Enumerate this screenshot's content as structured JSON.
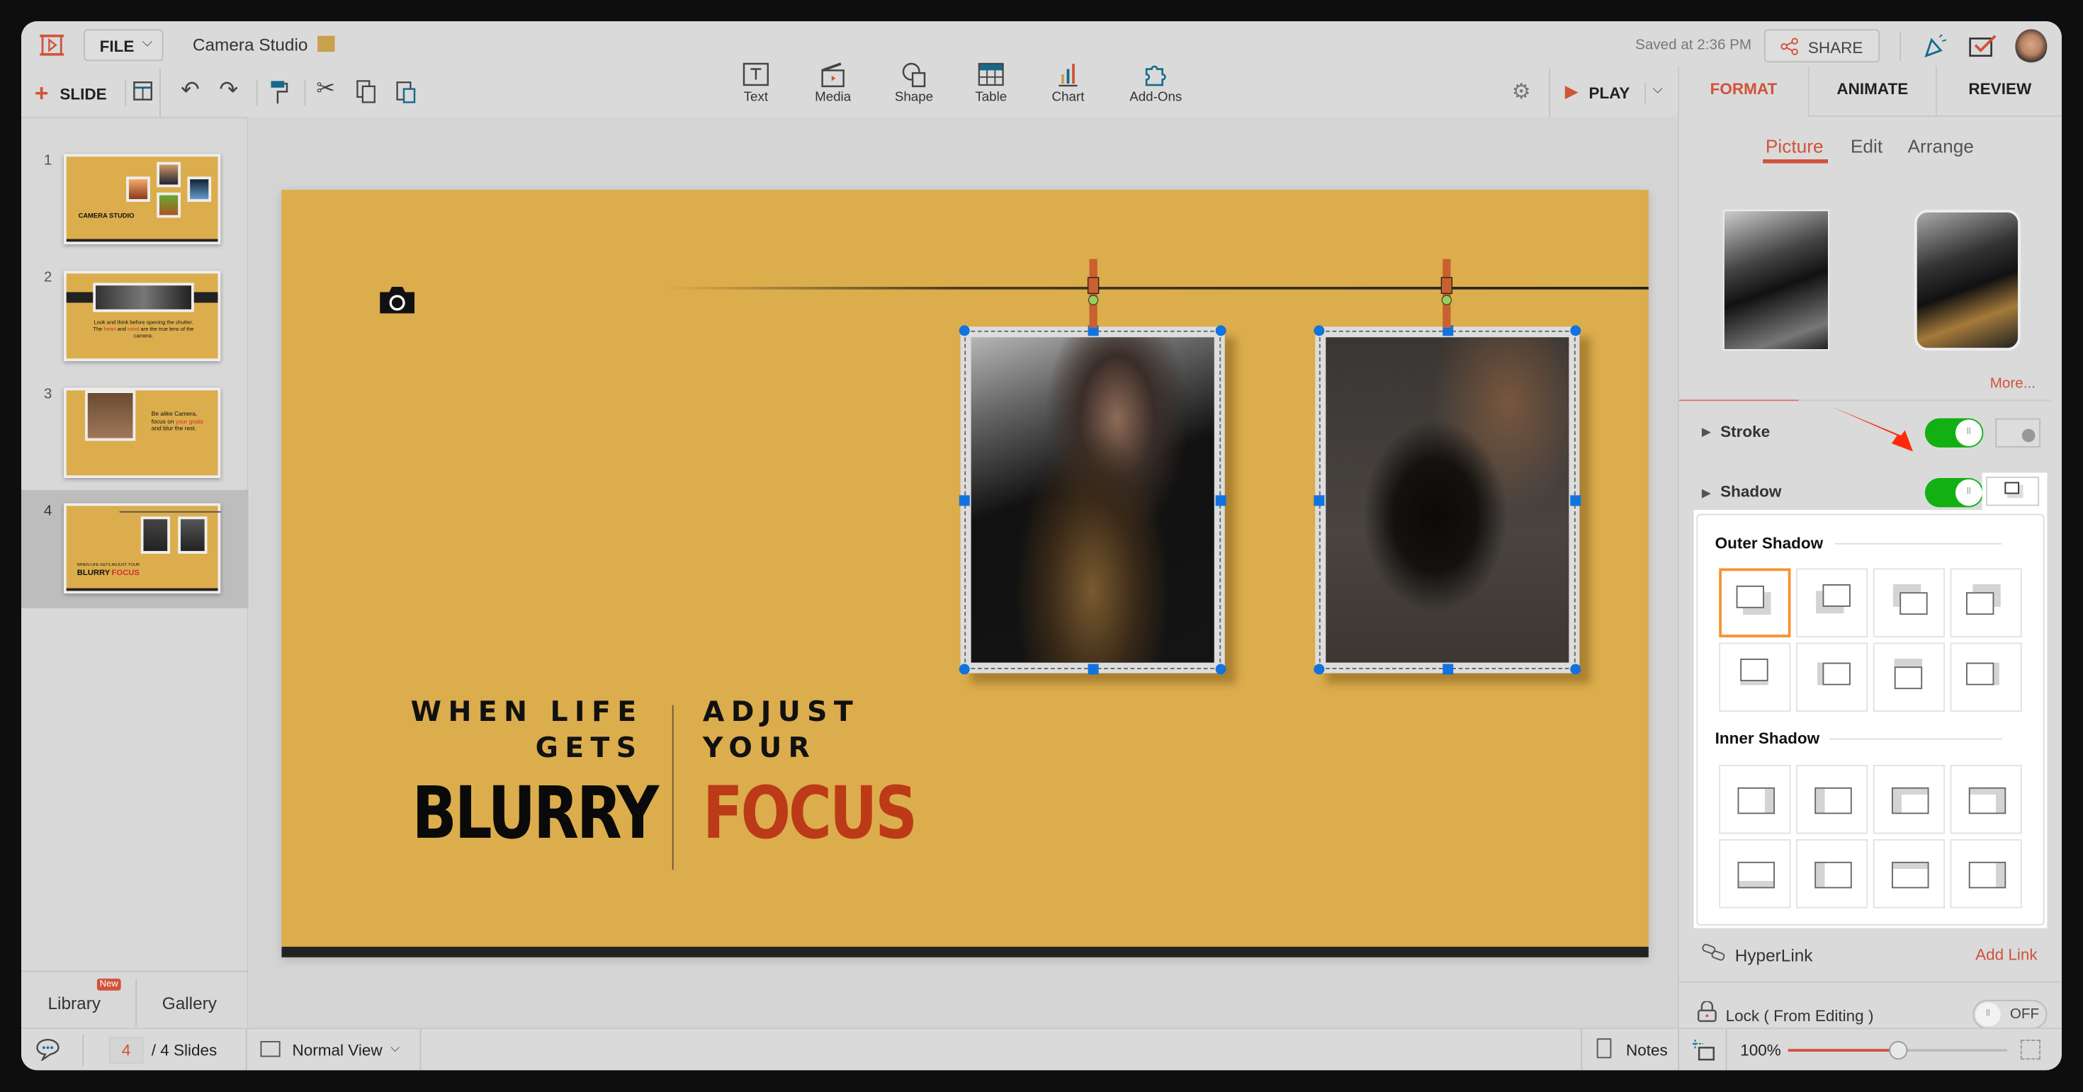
{
  "header": {
    "file_label": "FILE",
    "doc_title": "Camera Studio",
    "saved_status": "Saved at 2:36 PM",
    "share_label": "SHARE"
  },
  "toolbar": {
    "slide_label": "SLIDE",
    "insert_tools": [
      "Text",
      "Media",
      "Shape",
      "Table",
      "Chart",
      "Add-Ons"
    ],
    "play_label": "PLAY"
  },
  "right_tabs": [
    "FORMAT",
    "ANIMATE",
    "REVIEW"
  ],
  "sub_tabs": [
    "Picture",
    "Edit",
    "Arrange"
  ],
  "format_panel": {
    "more_label": "More...",
    "stroke_label": "Stroke",
    "stroke_on": true,
    "shadow_label": "Shadow",
    "shadow_on": true,
    "outer_shadow_title": "Outer Shadow",
    "inner_shadow_title": "Inner Shadow",
    "selected_outer_shadow": 1,
    "hyperlink_label": "HyperLink",
    "add_link_label": "Add Link",
    "lock_label": "Lock ( From Editing )",
    "lock_state": "OFF"
  },
  "slides_panel": {
    "numbers": [
      "1",
      "2",
      "3",
      "4"
    ],
    "active": 4,
    "thumb1_title": "CAMERA STUDIO",
    "thumb2_text_a": "Look and think before opening the shutter. The ",
    "thumb2_heart": "heart",
    "thumb2_and": " and ",
    "thumb2_mind": "mind",
    "thumb2_text_b": " are the true lens of the camera.",
    "thumb3_a": "Be alike Camera, focus on ",
    "thumb3_your": "your goals",
    "thumb3_b": " and blur the rest.",
    "thumb4_small": "WHEN LIFE GETS",
    "thumb4_small2": "ADJUST YOUR",
    "thumb4_blurry": "BLURRY",
    "thumb4_focus": "FOCUS",
    "library_label": "Library",
    "new_badge": "New",
    "gallery_label": "Gallery"
  },
  "slide": {
    "line1_left": "WHEN LIFE",
    "line2_left": "GETS",
    "big_left": "BLURRY",
    "line1_right": "ADJUST",
    "line2_right": "YOUR",
    "big_right": "FOCUS"
  },
  "status_bar": {
    "current_slide": "4",
    "total_slides": "/ 4 Slides",
    "view_mode": "Normal View",
    "notes_label": "Notes",
    "zoom_level": "100%",
    "zoom_percent": 100
  },
  "colors": {
    "accent": "#d0533b",
    "slide_bg": "#dcad4c",
    "focus_red": "#bc3a17",
    "toggle_on": "#12b012",
    "selection": "#1273de"
  }
}
